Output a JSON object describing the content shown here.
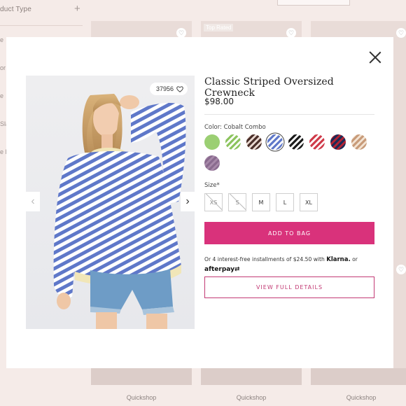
{
  "background": {
    "filter_title": "duct Type",
    "filter_partials": [
      "e",
      "or",
      "e",
      "Sla",
      "e F"
    ],
    "badge_top_rated": "Top Rated",
    "quickshop_labels": [
      "Quickshop",
      "Quickshop",
      "Quickshop"
    ],
    "heart_glyph": "♡"
  },
  "modal": {
    "close_icon": "close-icon",
    "image": {
      "like_count": "37956",
      "prev_glyph": "‹",
      "next_glyph": "›"
    },
    "product": {
      "title": "Classic Striped Oversized Crewneck",
      "price": "$98.00",
      "color_label": "Color: Cobalt Combo",
      "size_label": "Size*"
    },
    "swatches": [
      {
        "name": "light-green",
        "colors": [
          "#9bcf73",
          "#9bcf73"
        ],
        "selected": false
      },
      {
        "name": "green-stripe",
        "colors": [
          "#8cc45e",
          "#ffffff"
        ],
        "selected": false
      },
      {
        "name": "brown-stripe",
        "colors": [
          "#4a2f2a",
          "#e9d8d0"
        ],
        "selected": false
      },
      {
        "name": "cobalt-combo",
        "colors": [
          "#5f78c9",
          "#ffffff"
        ],
        "selected": true
      },
      {
        "name": "black-stripe",
        "colors": [
          "#1c1c1c",
          "#ffffff"
        ],
        "selected": false
      },
      {
        "name": "red-stripe",
        "colors": [
          "#cf3b4a",
          "#ffffff"
        ],
        "selected": false
      },
      {
        "name": "navy-red",
        "colors": [
          "#1f2a55",
          "#b52233"
        ],
        "selected": false
      },
      {
        "name": "tan-stripe",
        "colors": [
          "#c89b79",
          "#f2e3d3"
        ],
        "selected": false
      },
      {
        "name": "plum",
        "colors": [
          "#8a6b8f",
          "#a789a9"
        ],
        "selected": false
      }
    ],
    "sizes": [
      {
        "label": "XS",
        "out_of_stock": true
      },
      {
        "label": "S",
        "out_of_stock": true
      },
      {
        "label": "M",
        "out_of_stock": false
      },
      {
        "label": "L",
        "out_of_stock": false
      },
      {
        "label": "XL",
        "out_of_stock": false
      }
    ],
    "add_to_bag": "ADD TO BAG",
    "installments": {
      "prefix": "Or 4 interest-free installments of $24.50 with",
      "klarna": "Klarna.",
      "or": "or",
      "afterpay": "afterpay"
    },
    "view_details": "VIEW FULL DETAILS"
  },
  "colors": {
    "accent_pink": "#d9327b",
    "outline_pink": "#c23a74",
    "overlay_bg": "#f5ebe8"
  }
}
